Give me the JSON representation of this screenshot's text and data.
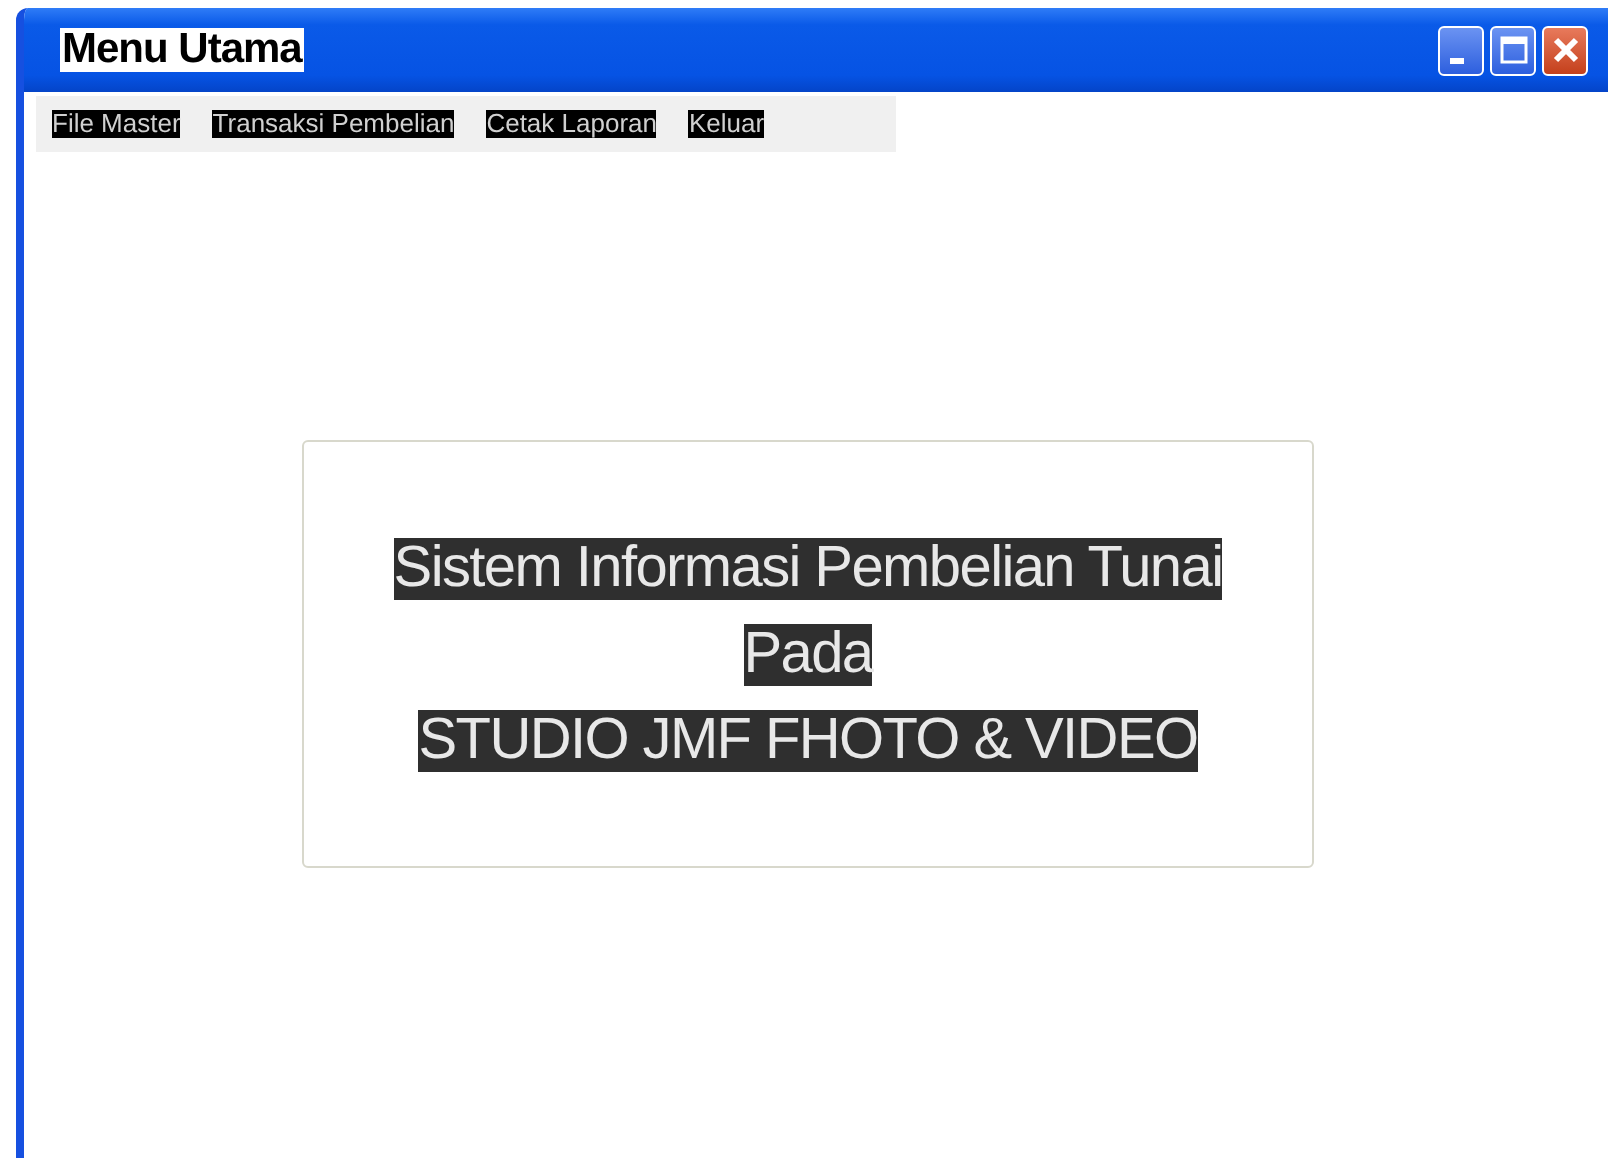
{
  "window": {
    "title": "Menu Utama"
  },
  "menu": [
    {
      "label": "File Master"
    },
    {
      "label": "Transaksi Pembelian"
    },
    {
      "label": "Cetak Laporan"
    },
    {
      "label": "Keluar"
    }
  ],
  "heading": {
    "lines": [
      "Sistem Informasi Pembelian Tunai",
      "Pada",
      "STUDIO JMF FHOTO & VIDEO"
    ]
  }
}
